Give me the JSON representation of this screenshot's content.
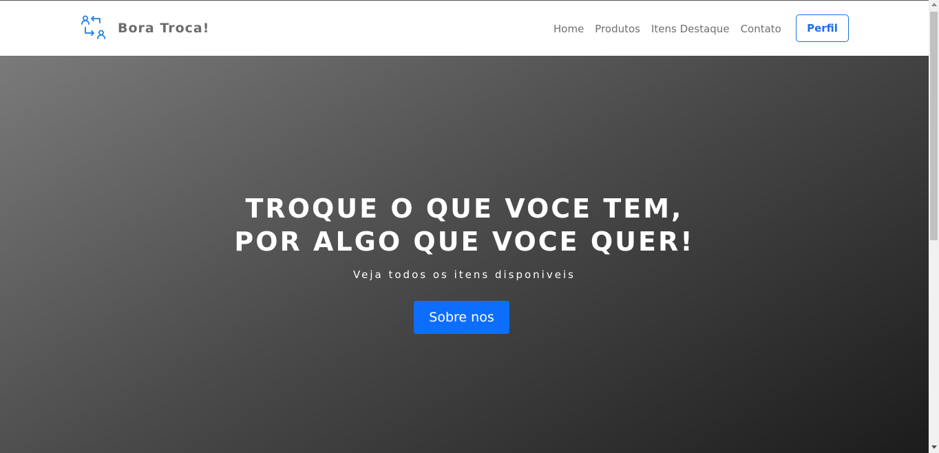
{
  "navbar": {
    "brand": {
      "name": "Bora Troca!",
      "icon": "person-exchange-icon",
      "icon_color": "#2f8be6"
    },
    "links": [
      {
        "label": "Home"
      },
      {
        "label": "Produtos"
      },
      {
        "label": "Itens Destaque"
      },
      {
        "label": "Contato"
      }
    ],
    "profile_button": "Perfil"
  },
  "hero": {
    "title_line1": "TROQUE O QUE VOCE TEM,",
    "title_line2": "POR ALGO QUE VOCE QUER!",
    "subtitle": "Veja todos os itens disponiveis",
    "button_label": "Sobre nos"
  },
  "colors": {
    "primary": "#0d6efd",
    "outline_accent": "#1a6fe8",
    "nav_text": "#6f6f6f",
    "hero_gradient_start": "#7a7a7a",
    "hero_gradient_end": "#1c1c1c"
  }
}
